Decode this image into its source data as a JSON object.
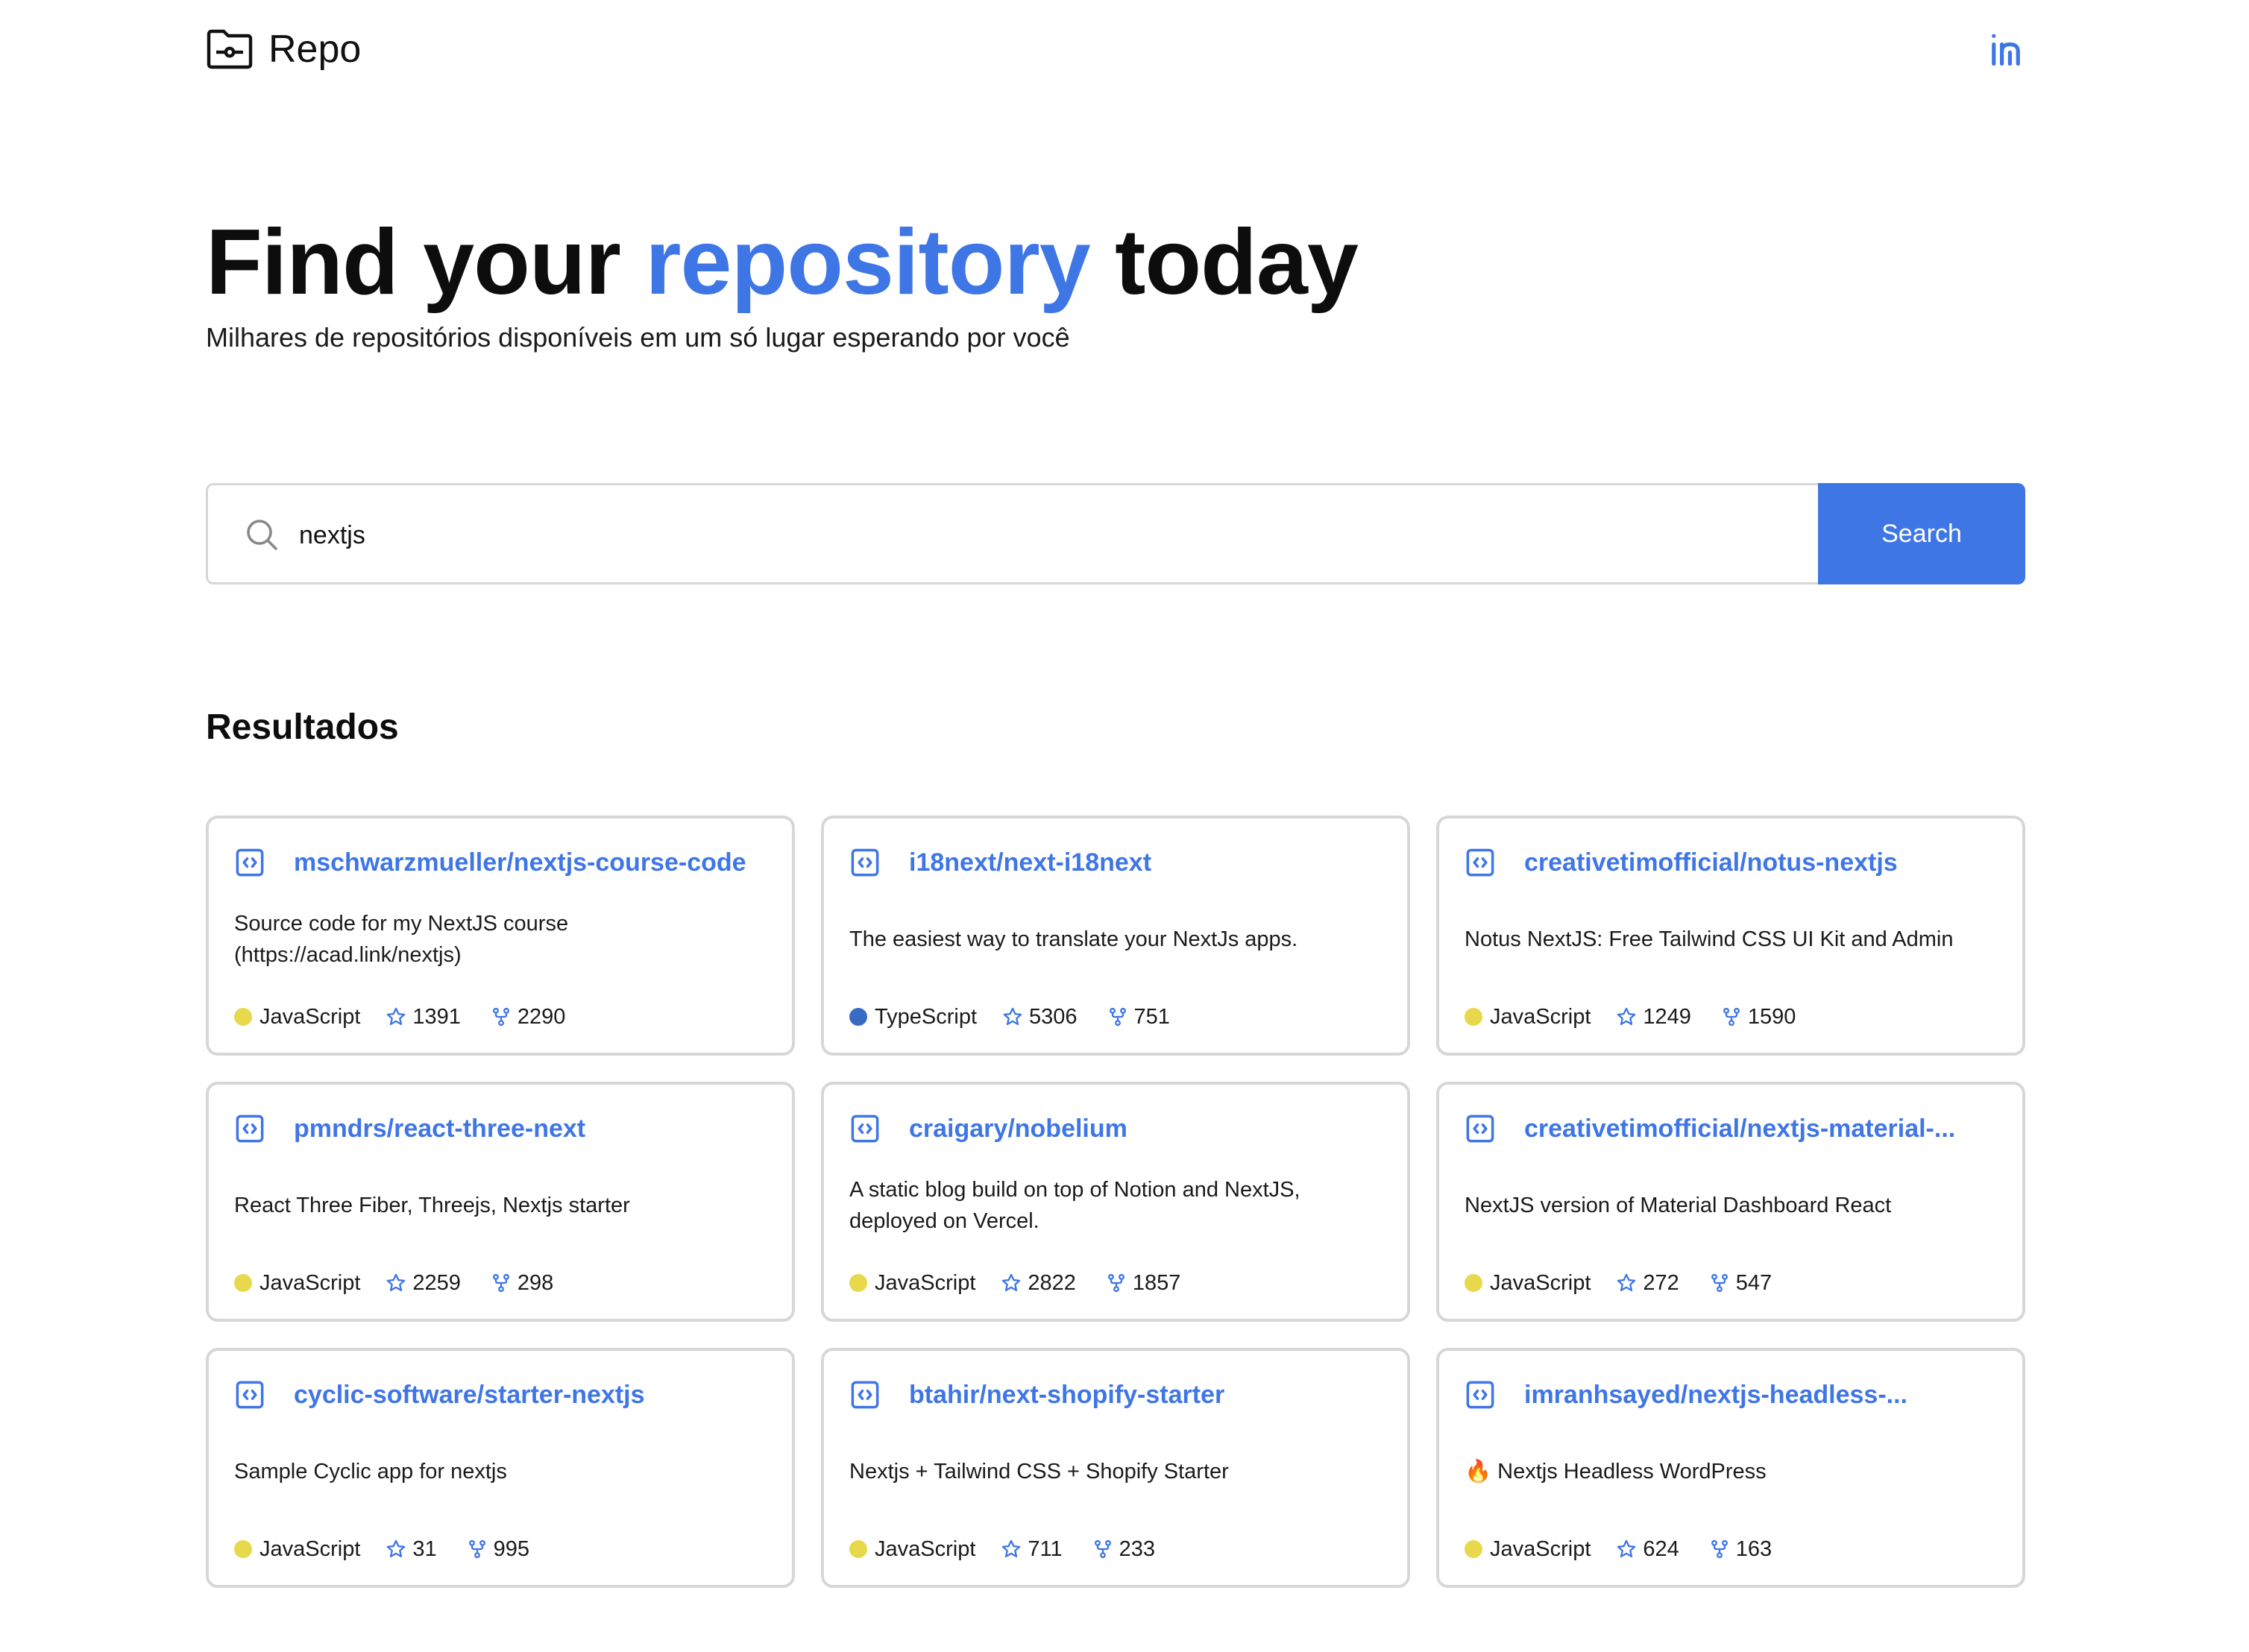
{
  "brand": {
    "name": "Repo"
  },
  "hero": {
    "title_part1": "Find your ",
    "title_accent": "repository",
    "title_part2": " today",
    "subtitle": "Milhares de repositórios disponíveis em um só lugar esperando por você"
  },
  "search": {
    "value": "nextjs",
    "button_label": "Search"
  },
  "results": {
    "title": "Resultados",
    "repos": [
      {
        "name": "mschwarzmueller/nextjs-course-code",
        "description": "Source code for my NextJS course (https://acad.link/nextjs)",
        "language": "JavaScript",
        "language_color": "#e8d84b",
        "stars": "1391",
        "forks": "2290"
      },
      {
        "name": "i18next/next-i18next",
        "description": "The easiest way to translate your NextJs apps.",
        "language": "TypeScript",
        "language_color": "#3a6bc4",
        "stars": "5306",
        "forks": "751"
      },
      {
        "name": "creativetimofficial/notus-nextjs",
        "description": "Notus NextJS: Free Tailwind CSS UI Kit and Admin",
        "language": "JavaScript",
        "language_color": "#e8d84b",
        "stars": "1249",
        "forks": "1590"
      },
      {
        "name": "pmndrs/react-three-next",
        "description": "React Three Fiber, Threejs, Nextjs starter",
        "language": "JavaScript",
        "language_color": "#e8d84b",
        "stars": "2259",
        "forks": "298"
      },
      {
        "name": "craigary/nobelium",
        "description": "A static blog build on top of Notion and NextJS, deployed on Vercel.",
        "language": "JavaScript",
        "language_color": "#e8d84b",
        "stars": "2822",
        "forks": "1857"
      },
      {
        "name": "creativetimofficial/nextjs-material-...",
        "description": "NextJS version of Material Dashboard React",
        "language": "JavaScript",
        "language_color": "#e8d84b",
        "stars": "272",
        "forks": "547"
      },
      {
        "name": "cyclic-software/starter-nextjs",
        "description": "Sample Cyclic app for nextjs",
        "language": "JavaScript",
        "language_color": "#e8d84b",
        "stars": "31",
        "forks": "995"
      },
      {
        "name": "btahir/next-shopify-starter",
        "description": "Nextjs + Tailwind CSS + Shopify Starter",
        "language": "JavaScript",
        "language_color": "#e8d84b",
        "stars": "711",
        "forks": "233"
      },
      {
        "name": "imranhsayed/nextjs-headless-...",
        "description": "🔥 Nextjs Headless WordPress",
        "language": "JavaScript",
        "language_color": "#e8d84b",
        "stars": "624",
        "forks": "163"
      }
    ]
  },
  "icons": {
    "brand": "folder-git-icon",
    "social": "linkedin-icon",
    "search": "search-icon",
    "repo": "code-file-icon",
    "stars": "star-icon",
    "forks": "fork-icon"
  },
  "colors": {
    "accent": "#3f76e6",
    "border": "#d7d7d7",
    "javascript": "#e8d84b",
    "typescript": "#3a6bc4"
  }
}
